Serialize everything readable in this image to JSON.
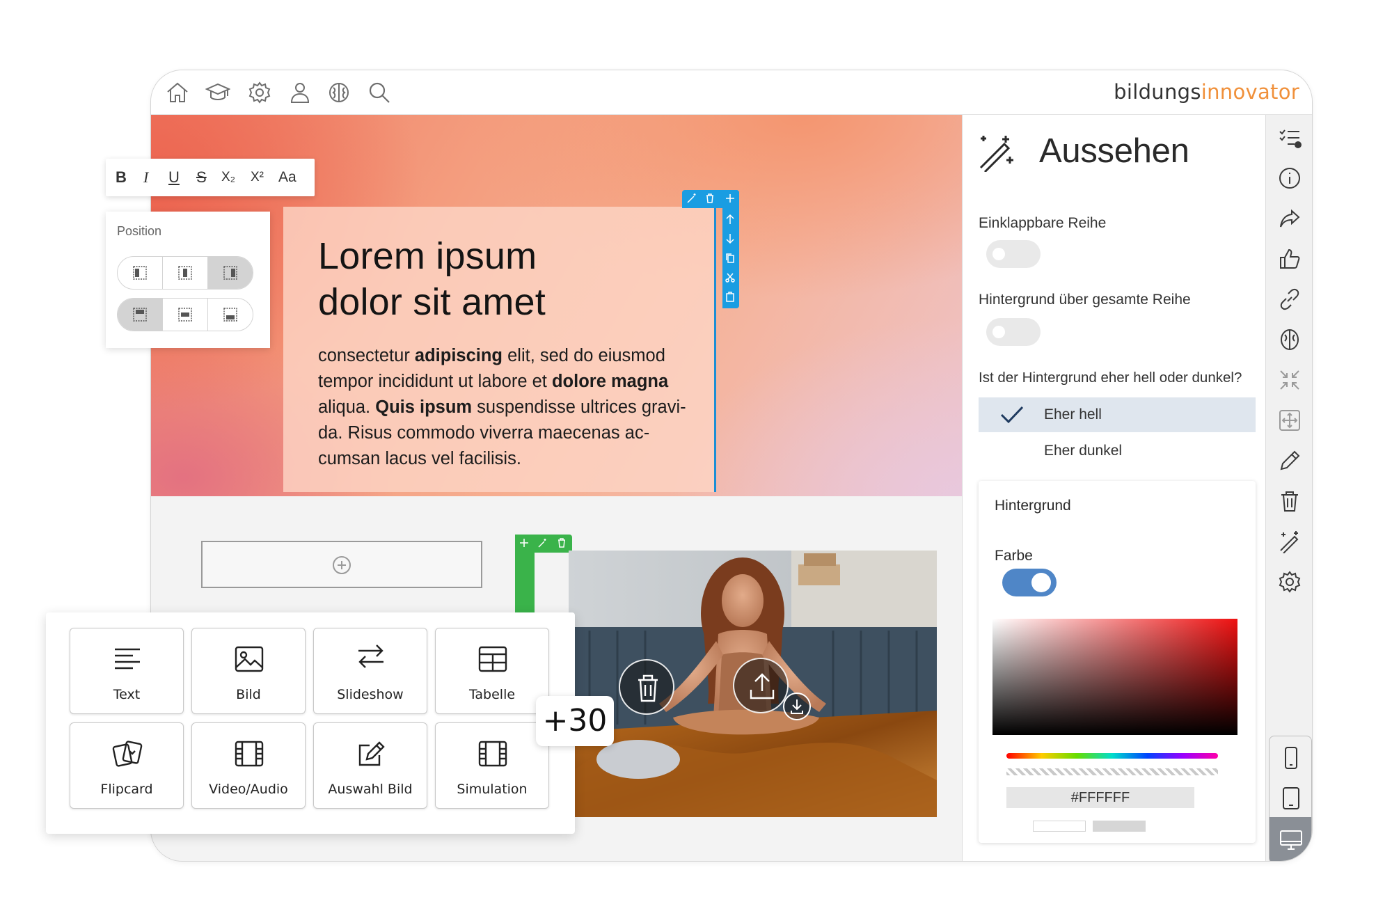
{
  "brand": {
    "logo_part1": "bildungs",
    "logo_part2": "innovator",
    "accent": "#f0903a"
  },
  "topnav": {
    "icons": [
      "home-icon",
      "graduation-cap-icon",
      "gear-icon",
      "user-icon",
      "brain-icon",
      "search-icon"
    ]
  },
  "hero": {
    "title_line1": "Lorem ipsum",
    "title_line2": "dolor sit amet",
    "body": {
      "t1": "consectetur ",
      "b1": "adipiscing",
      "t2": " elit, sed do eiusmod tempor incididunt ut labore et ",
      "b2": "dolore magna",
      "t3": " aliqua. ",
      "b3": "Quis ipsum",
      "t4": " suspendisse ultrices gravi-da. Risus commodo viverra maecenas ac-cumsan lacus vel facilisis."
    }
  },
  "format_toolbar": {
    "bold": "B",
    "italic": "I",
    "underline": "U",
    "strike": "S",
    "subscript": "X₂",
    "superscript": "X²",
    "font": "Aa"
  },
  "position_panel": {
    "title": "Position"
  },
  "components": [
    {
      "label": "Text",
      "icon": "text-lines-icon"
    },
    {
      "label": "Bild",
      "icon": "image-icon"
    },
    {
      "label": "Slideshow",
      "icon": "slideshow-arrows-icon"
    },
    {
      "label": "Tabelle",
      "icon": "table-icon"
    },
    {
      "label": "Flipcard",
      "icon": "flipcard-icon"
    },
    {
      "label": "Video/Audio",
      "icon": "film-icon"
    },
    {
      "label": "Auswahl Bild",
      "icon": "edit-image-icon"
    },
    {
      "label": "Simulation",
      "icon": "film-icon"
    }
  ],
  "more_badge": "+30",
  "panel": {
    "title": "Aussehen",
    "collapsible_label": "Einklappbare Reihe",
    "collapsible_on": false,
    "fullrow_label": "Hintergrund über gesamte Reihe",
    "fullrow_on": false,
    "question": "Ist der Hintergrund eher hell oder dunkel?",
    "options": [
      "Eher hell",
      "Eher dunkel"
    ],
    "selected": "Eher hell",
    "bg_title": "Hintergrund",
    "color_label": "Farbe",
    "color_on": true,
    "hex": "#FFFFFF"
  },
  "rail_icons": [
    "checklist-icon",
    "info-icon",
    "share-icon",
    "thumbs-up-icon",
    "link-icon",
    "brain-icon",
    "shrink-icon",
    "move-icon",
    "pencil-icon",
    "trash-icon",
    "magic-wand-icon",
    "gear-icon"
  ],
  "devices": [
    "phone-icon",
    "tablet-icon",
    "desktop-icon"
  ]
}
